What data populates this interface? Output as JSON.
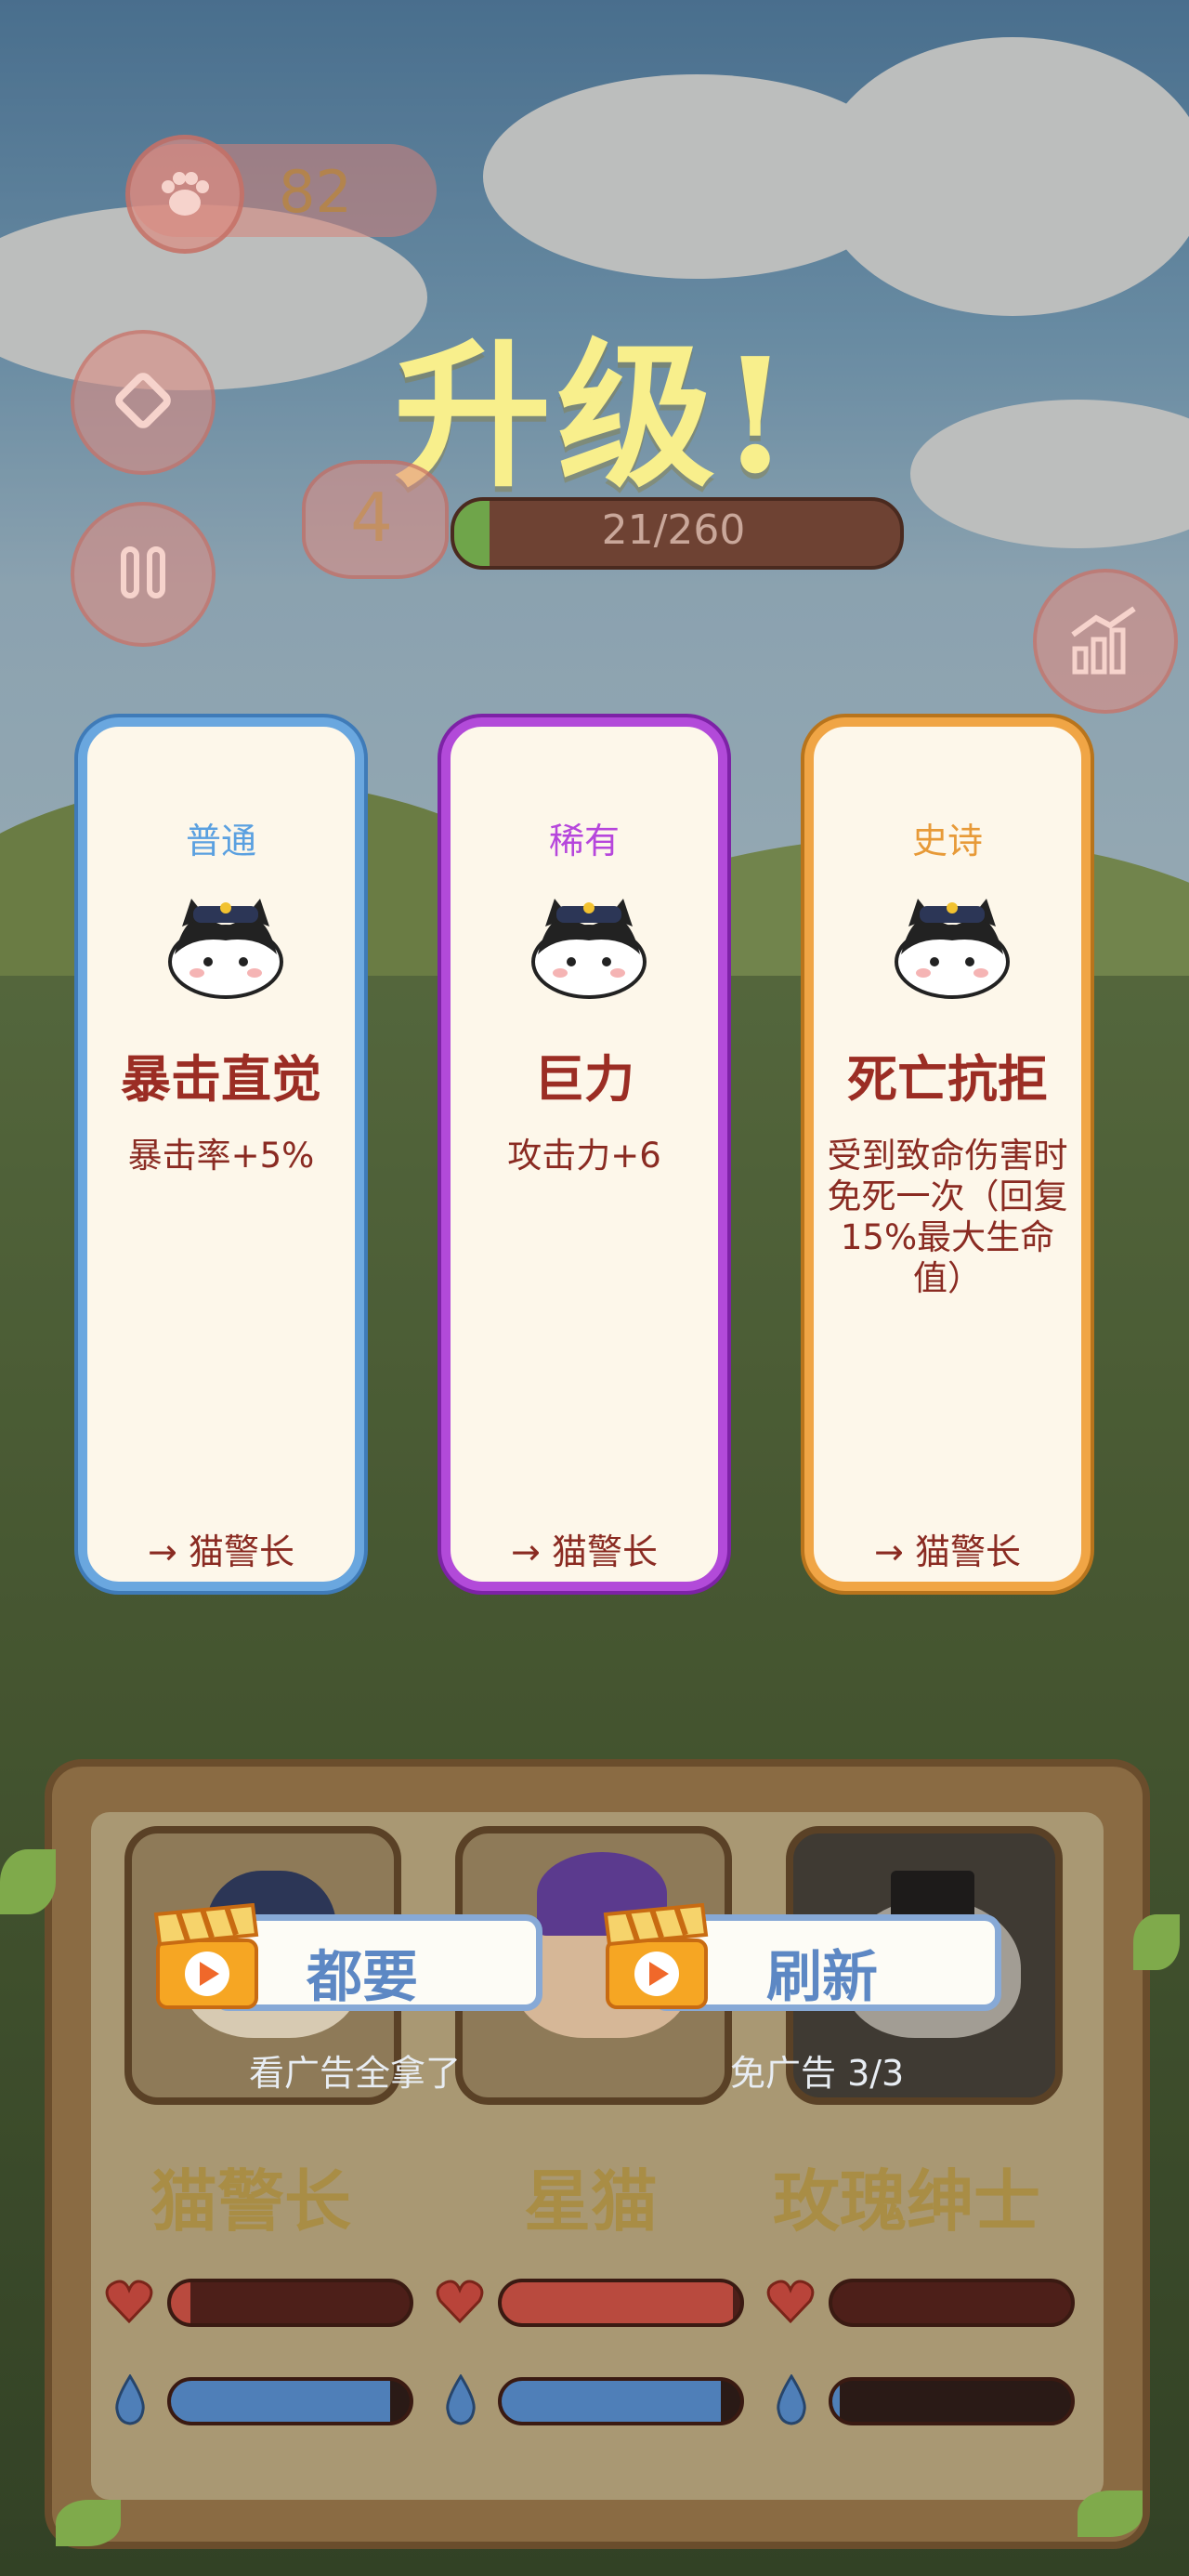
{
  "hud": {
    "coins": "82",
    "level": "4",
    "xp_text": "21/260",
    "xp_fraction": 0.08
  },
  "title": "升级!",
  "cards": [
    {
      "rarity": "普通",
      "rarity_color": "#5aa0e0",
      "skill": "暴击直觉",
      "desc": "暴击率+5%",
      "target": "→ 猫警长"
    },
    {
      "rarity": "稀有",
      "rarity_color": "#b646dc",
      "skill": "巨力",
      "desc": "攻击力+6",
      "target": "→ 猫警长"
    },
    {
      "rarity": "史诗",
      "rarity_color": "#e79a38",
      "skill": "死亡抗拒",
      "desc": "受到致命伤害时免死一次（回复15%最大生命值）",
      "target": "→ 猫警长"
    }
  ],
  "ad_buttons": [
    {
      "label": "都要",
      "sub": "看广告全拿了"
    },
    {
      "label": "刷新",
      "sub": "免广告 3/3"
    }
  ],
  "team": [
    {
      "name": "猫警长",
      "hp": 0.08,
      "mp": 0.92
    },
    {
      "name": "星猫",
      "hp": 0.97,
      "mp": 0.92
    },
    {
      "name": "玫瑰绅士",
      "hp": 0.0,
      "mp": 0.03
    }
  ]
}
